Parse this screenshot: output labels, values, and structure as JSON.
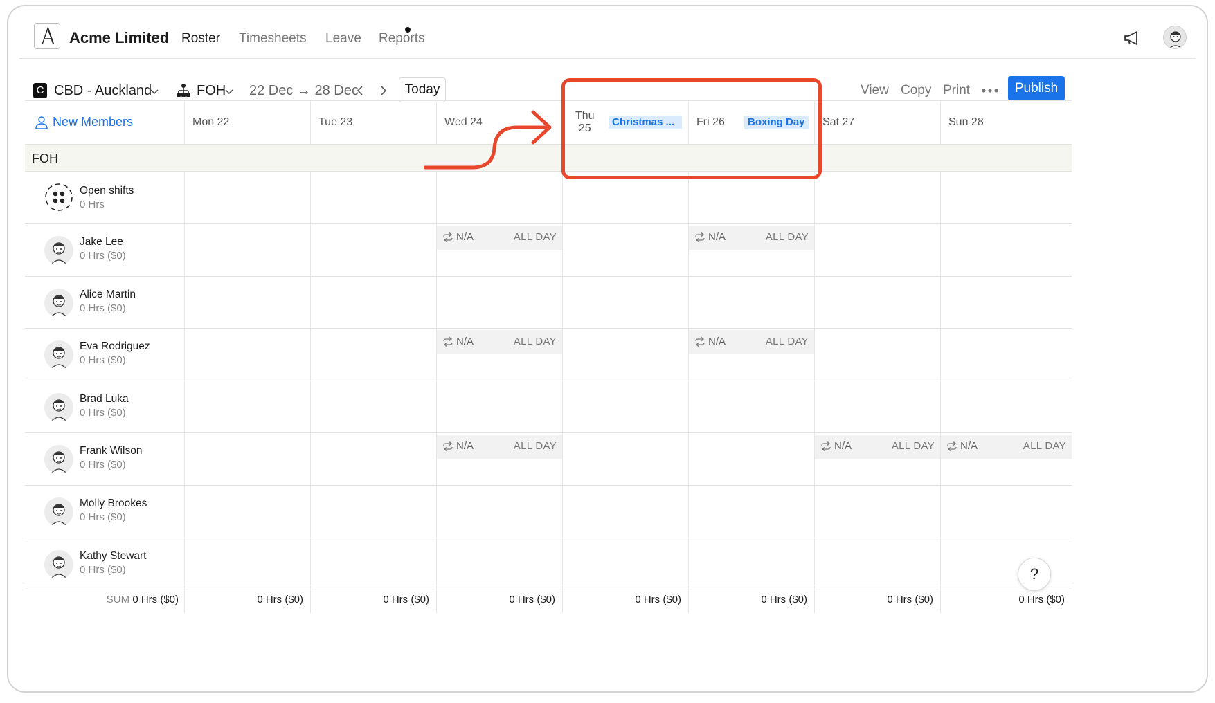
{
  "app": {
    "company": "Acme Limited",
    "logo_letter": "A"
  },
  "nav": {
    "items": [
      {
        "label": "Roster",
        "active": true
      },
      {
        "label": "Timesheets",
        "active": false
      },
      {
        "label": "Leave",
        "active": false
      },
      {
        "label": "Reports",
        "active": false
      }
    ]
  },
  "toolbar": {
    "location_badge": "C",
    "location": "CBD - Auckland",
    "team": "FOH",
    "date_range": "22 Dec → 28 Dec",
    "today_label": "Today",
    "view_label": "View",
    "copy_label": "Copy",
    "print_label": "Print",
    "publish_label": "Publish"
  },
  "grid": {
    "new_members_label": "New Members",
    "days": [
      {
        "label": "Mon 22",
        "line1": "",
        "line2": "",
        "holiday": ""
      },
      {
        "label": "Tue 23",
        "line1": "",
        "line2": "",
        "holiday": ""
      },
      {
        "label": "Wed 24",
        "line1": "",
        "line2": "",
        "holiday": ""
      },
      {
        "label": "",
        "line1": "Thu",
        "line2": "25",
        "holiday": "Christmas ..."
      },
      {
        "label": "Fri 26",
        "line1": "",
        "line2": "",
        "holiday": "Boxing Day"
      },
      {
        "label": "Sat 27",
        "line1": "",
        "line2": "",
        "holiday": ""
      },
      {
        "label": "Sun 28",
        "line1": "",
        "line2": "",
        "holiday": ""
      }
    ],
    "section": "FOH",
    "open_shifts": {
      "name": "Open shifts",
      "hours": "0 Hrs"
    },
    "unavailable_label": "N/A",
    "all_day_label": "ALL DAY",
    "employees": [
      {
        "name": "Jake Lee",
        "hours": "0 Hrs ($0)",
        "unavailable": [
          2,
          4
        ]
      },
      {
        "name": "Alice Martin",
        "hours": "0 Hrs ($0)",
        "unavailable": []
      },
      {
        "name": "Eva Rodriguez",
        "hours": "0 Hrs ($0)",
        "unavailable": [
          2,
          4
        ]
      },
      {
        "name": "Brad Luka",
        "hours": "0 Hrs ($0)",
        "unavailable": []
      },
      {
        "name": "Frank Wilson",
        "hours": "0 Hrs ($0)",
        "unavailable": [
          2,
          5,
          6
        ]
      },
      {
        "name": "Molly Brookes",
        "hours": "0 Hrs ($0)",
        "unavailable": []
      },
      {
        "name": "Kathy Stewart",
        "hours": "0 Hrs ($0)",
        "unavailable": []
      }
    ],
    "sum_label": "SUM",
    "sum_values": [
      "0 Hrs ($0)",
      "0 Hrs ($0)",
      "0 Hrs ($0)",
      "0 Hrs ($0)",
      "0 Hrs ($0)",
      "0 Hrs ($0)",
      "0 Hrs ($0)",
      "0 Hrs ($0)"
    ]
  },
  "help_label": "?",
  "colors": {
    "accent": "#1a73e8",
    "annotation": "#e8472b",
    "holiday_bg": "#d9ebfc",
    "section_bg": "#f6f6f1"
  }
}
